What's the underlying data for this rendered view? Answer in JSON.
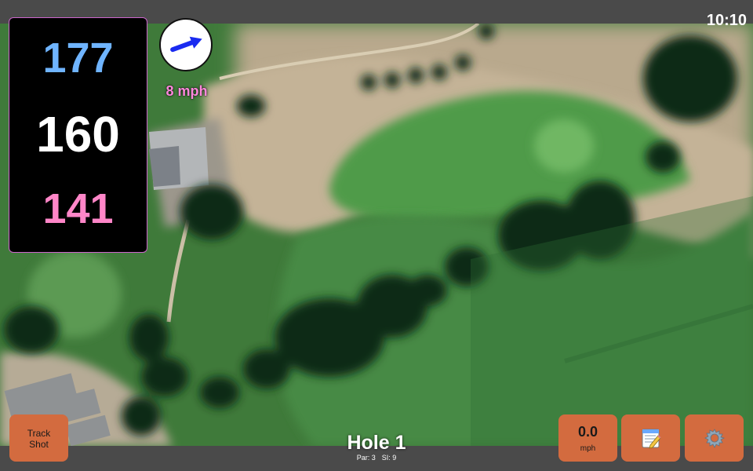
{
  "status": {
    "time": "10:10"
  },
  "distances": {
    "back": "177",
    "middle": "160",
    "front": "141"
  },
  "wind": {
    "speed_label": "8 mph",
    "arrow_icon": "wind-direction-arrow-icon"
  },
  "hole": {
    "title": "Hole 1",
    "par": "Par: 3",
    "stroke_index": "SI: 9"
  },
  "buttons": {
    "track_shot_line1": "Track",
    "track_shot_line2": "Shot",
    "speed_value": "0.0",
    "speed_unit": "mph",
    "notes_icon": "notepad-icon",
    "settings_icon": "gear-icon"
  },
  "colors": {
    "back": "#6fb4ff",
    "middle": "#ffffff",
    "front": "#ff86c8",
    "wind_text": "#ff88dd",
    "button": "#d36b3f",
    "arrow": "#1a2bf0"
  }
}
